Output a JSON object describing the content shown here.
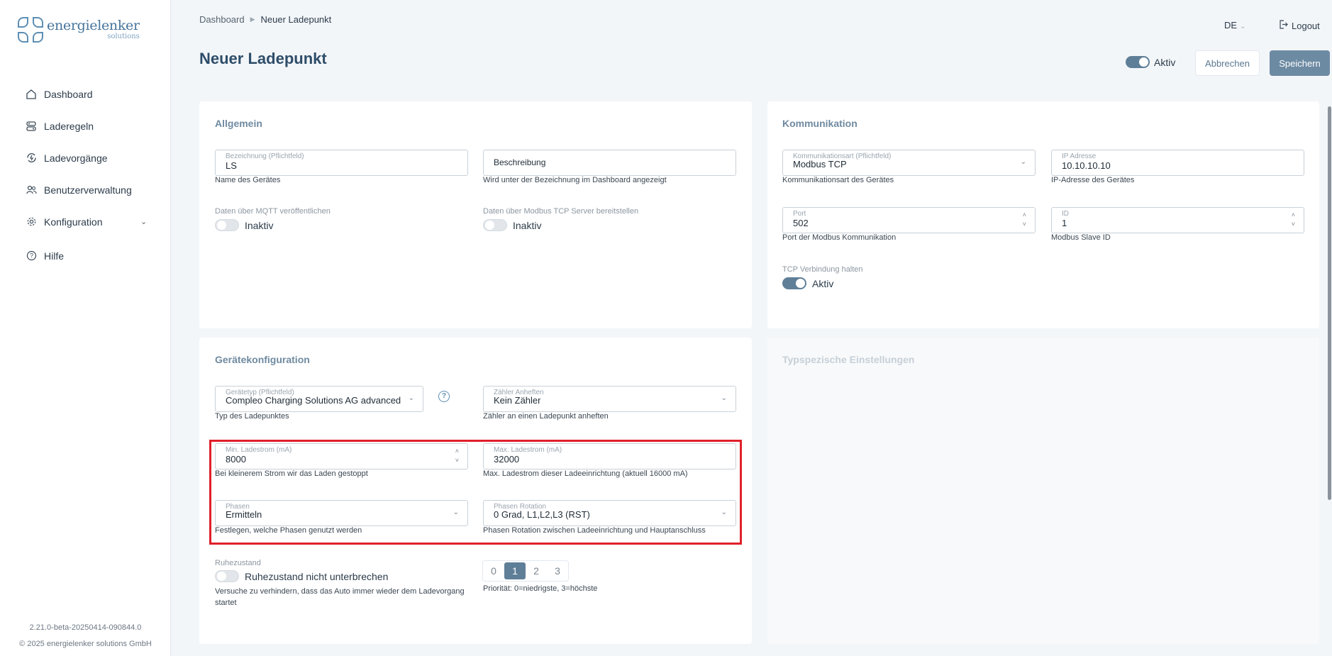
{
  "brand": {
    "name": "energielenker",
    "sub": "solutions"
  },
  "nav": [
    {
      "label": "Dashboard",
      "icon": "home-icon"
    },
    {
      "label": "Laderegeln",
      "icon": "rules-icon"
    },
    {
      "label": "Ladevorgänge",
      "icon": "charging-sessions-icon"
    },
    {
      "label": "Benutzerverwaltung",
      "icon": "users-icon"
    },
    {
      "label": "Konfiguration",
      "icon": "gear-icon"
    },
    {
      "label": "Hilfe",
      "icon": "help-icon"
    }
  ],
  "footer": {
    "version": "2.21.0-beta-20250414-090844.0",
    "copyright": "© 2025 energielenker solutions GmbH"
  },
  "breadcrumb": {
    "root": "Dashboard",
    "current": "Neuer Ladepunkt"
  },
  "header": {
    "lang": "DE",
    "logout": "Logout",
    "title": "Neuer Ladepunkt",
    "active_label": "Aktiv",
    "cancel": "Abbrechen",
    "save": "Speichern"
  },
  "allgemein": {
    "title": "Allgemein",
    "bezeichnung": {
      "label": "Bezeichnung (Pflichtfeld)",
      "value": "LS",
      "hint": "Name des Gerätes"
    },
    "beschreibung": {
      "placeholder": "Beschreibung",
      "hint": "Wird unter der Bezeichnung im Dashboard angezeigt"
    },
    "mqtt": {
      "label": "Daten über MQTT veröffentlichen",
      "state": "Inaktiv"
    },
    "modbus_server": {
      "label": "Daten über Modbus TCP Server bereitstellen",
      "state": "Inaktiv"
    }
  },
  "kommunikation": {
    "title": "Kommunikation",
    "art": {
      "label": "Kommunikationsart (Pflichtfeld)",
      "value": "Modbus TCP",
      "hint": "Kommunikationsart des Gerätes"
    },
    "ip": {
      "label": "IP Adresse",
      "value": "10.10.10.10",
      "hint": "IP-Adresse des Gerätes"
    },
    "port": {
      "label": "Port",
      "value": "502",
      "hint": "Port der Modbus Kommunikation"
    },
    "id": {
      "label": "ID",
      "value": "1",
      "hint": "Modbus Slave ID"
    },
    "tcp": {
      "label": "TCP Verbindung halten",
      "state": "Aktiv"
    }
  },
  "geraet": {
    "title": "Gerätekonfiguration",
    "typ": {
      "label": "Gerätetyp (Pflichtfeld)",
      "value": "Compleo Charging Solutions AG advanced (...",
      "hint": "Typ des Ladepunktes"
    },
    "zaehler": {
      "label": "Zähler Anheften",
      "value": "Kein Zähler",
      "hint": "Zähler an einen Ladepunkt anheften"
    },
    "min": {
      "label": "Min. Ladestrom (mA)",
      "value": "8000",
      "hint": "Bei kleinerem Strom wir das Laden gestoppt"
    },
    "max": {
      "label": "Max. Ladestrom (mA)",
      "value": "32000",
      "hint": "Max. Ladestrom dieser Ladeeinrichtung (aktuell 16000 mA)"
    },
    "phasen": {
      "label": "Phasen",
      "value": "Ermitteln",
      "hint": "Festlegen, welche Phasen genutzt werden"
    },
    "rotation": {
      "label": "Phasen Rotation",
      "value": "0 Grad, L1,L2,L3 (RST)",
      "hint": "Phasen Rotation zwischen Ladeeinrichtung und Hauptanschluss"
    },
    "ruhe": {
      "label": "Ruhezustand",
      "state": "Ruhezustand nicht unterbrechen",
      "hint1": "Versuche zu verhindern, dass das Auto immer wieder dem Ladevorgang",
      "hint2": "startet"
    },
    "prio": {
      "options": [
        "0",
        "1",
        "2",
        "3"
      ],
      "selected": "1",
      "hint": "Priorität: 0=niedrigste, 3=höchste"
    }
  },
  "typ_einstellungen": {
    "title": "Typspezische Einstellungen"
  }
}
